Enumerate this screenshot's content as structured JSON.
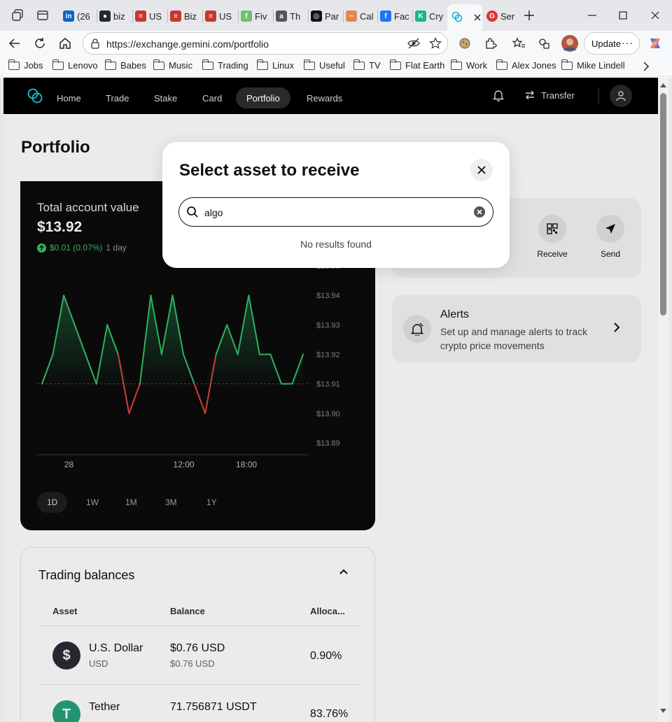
{
  "browser": {
    "tabs": [
      {
        "label": "(26",
        "icon": "linkedin-icon",
        "color": "#0a66c2",
        "glyph": "in"
      },
      {
        "label": "biz",
        "icon": "github-icon",
        "color": "#24292f",
        "glyph": "●"
      },
      {
        "label": "US",
        "icon": "flag-icon",
        "color": "#c9342f",
        "glyph": "≡"
      },
      {
        "label": "Biz",
        "icon": "flag-icon",
        "color": "#c9342f",
        "glyph": "≡"
      },
      {
        "label": "US",
        "icon": "flag-icon",
        "color": "#c9342f",
        "glyph": "≡"
      },
      {
        "label": "Fiv",
        "icon": "site-icon",
        "color": "#6fbf73",
        "glyph": "f"
      },
      {
        "label": "Th",
        "icon": "amazon-icon",
        "color": "#555555",
        "glyph": "a"
      },
      {
        "label": "Par",
        "icon": "openai-icon",
        "color": "#111111",
        "glyph": "◎"
      },
      {
        "label": "Cal",
        "icon": "site-icon",
        "color": "#e08850",
        "glyph": "~"
      },
      {
        "label": "Fac",
        "icon": "facebook-icon",
        "color": "#1877f2",
        "glyph": "f"
      },
      {
        "label": "Cry",
        "icon": "kucoin-icon",
        "color": "#1bb28c",
        "glyph": "K"
      }
    ],
    "active_tab_icon": "gemini-icon",
    "last_tab": {
      "label": "Ser",
      "icon": "site-icon",
      "color": "#e0322e",
      "glyph": "G"
    },
    "url": "https://exchange.gemini.com/portfolio",
    "update_label": "Update",
    "bookmarks": [
      "Jobs",
      "Lenovo",
      "Babes",
      "Music",
      "Trading",
      "Linux",
      "Useful",
      "TV",
      "Flat Earth",
      "Work",
      "Alex Jones",
      "Mike Lindell"
    ]
  },
  "nav": {
    "items": [
      "Home",
      "Trade",
      "Stake",
      "Card",
      "Portfolio",
      "Rewards"
    ],
    "active": "Portfolio",
    "transfer_label": "Transfer"
  },
  "page": {
    "title": "Portfolio"
  },
  "chart_card": {
    "caption": "Total account value",
    "value": "$13.92",
    "change": "$0.01 (0.07%)",
    "period": "1 day",
    "ranges": [
      "1D",
      "1W",
      "1M",
      "3M",
      "1Y"
    ],
    "active_range": "1D"
  },
  "chart_data": {
    "type": "line",
    "x_tick_labels": [
      "28",
      "12:00",
      "18:00"
    ],
    "y_tick_labels": [
      "$13.95",
      "$13.94",
      "$13.93",
      "$13.92",
      "$13.91",
      "$13.90",
      "$13.89"
    ],
    "ylim": [
      13.885,
      13.955
    ],
    "baseline": 13.91,
    "values": [
      13.91,
      13.92,
      13.94,
      13.93,
      13.92,
      13.91,
      13.93,
      13.92,
      13.9,
      13.91,
      13.94,
      13.92,
      13.94,
      13.92,
      13.91,
      13.9,
      13.92,
      13.93,
      13.92,
      13.94,
      13.92,
      13.92,
      13.91,
      13.91,
      13.92
    ],
    "up_color": "#33c06a",
    "down_color": "#e0453a",
    "grid": false
  },
  "actions": {
    "receive": "Receive",
    "send": "Send"
  },
  "alerts": {
    "title": "Alerts",
    "description": "Set up and manage alerts to track crypto price movements"
  },
  "balances": {
    "title": "Trading balances",
    "columns": [
      "Asset",
      "Balance",
      "Alloca..."
    ],
    "rows": [
      {
        "name": "U.S. Dollar",
        "symbol": "USD",
        "balance": "$0.76 USD",
        "balance_sub": "$0.76 USD",
        "allocation": "0.90%",
        "coin_color": "#2b2b35",
        "coin_glyph": "$"
      },
      {
        "name": "Tether",
        "symbol": "",
        "balance": "71.756871 USDT",
        "balance_sub": "",
        "allocation": "83.76%",
        "coin_color": "#26a17b",
        "coin_glyph": "T"
      }
    ]
  },
  "modal": {
    "title": "Select asset to receive",
    "search_value": "algo",
    "no_results": "No results found"
  }
}
